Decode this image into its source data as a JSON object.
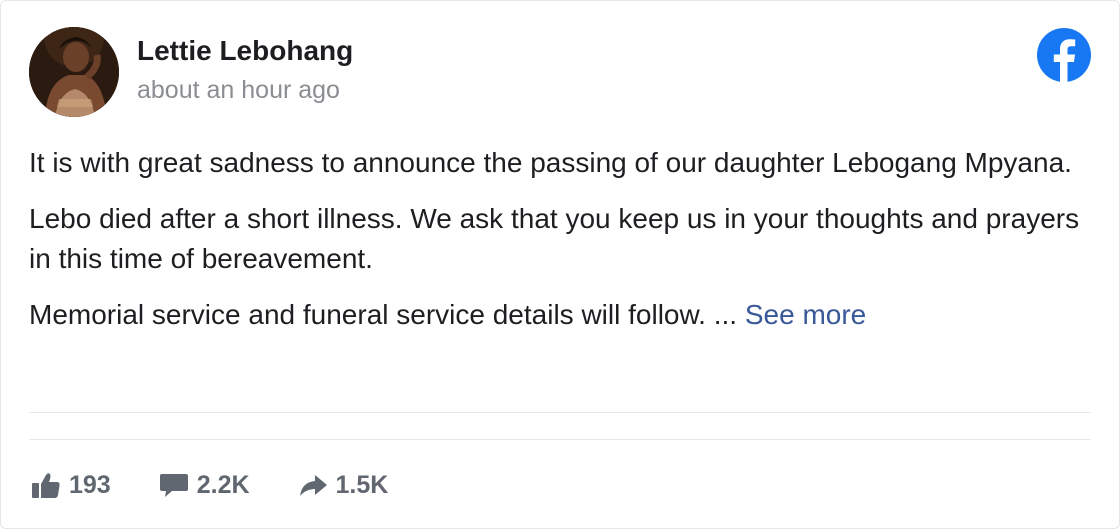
{
  "post": {
    "author_name": "Lettie Lebohang",
    "timestamp": "about an hour ago",
    "paragraphs": [
      "It is with great sadness to announce the passing of our daughter Lebogang Mpyana.",
      "Lebo died after a short illness. We ask that you keep us in your thoughts and prayers in this time of bereavement.",
      "Memorial service and funeral service details will follow. ..."
    ],
    "see_more_label": "See more"
  },
  "stats": {
    "likes": "193",
    "comments": "2.2K",
    "shares": "1.5K"
  },
  "icons": {
    "brand": "facebook-logo-icon",
    "like": "thumbs-up-icon",
    "comment": "comment-bubble-icon",
    "share": "share-arrow-icon"
  },
  "colors": {
    "facebook_blue": "#1877f2",
    "link_blue": "#385898",
    "muted_gray": "#8a8d91",
    "icon_gray": "#606770"
  }
}
